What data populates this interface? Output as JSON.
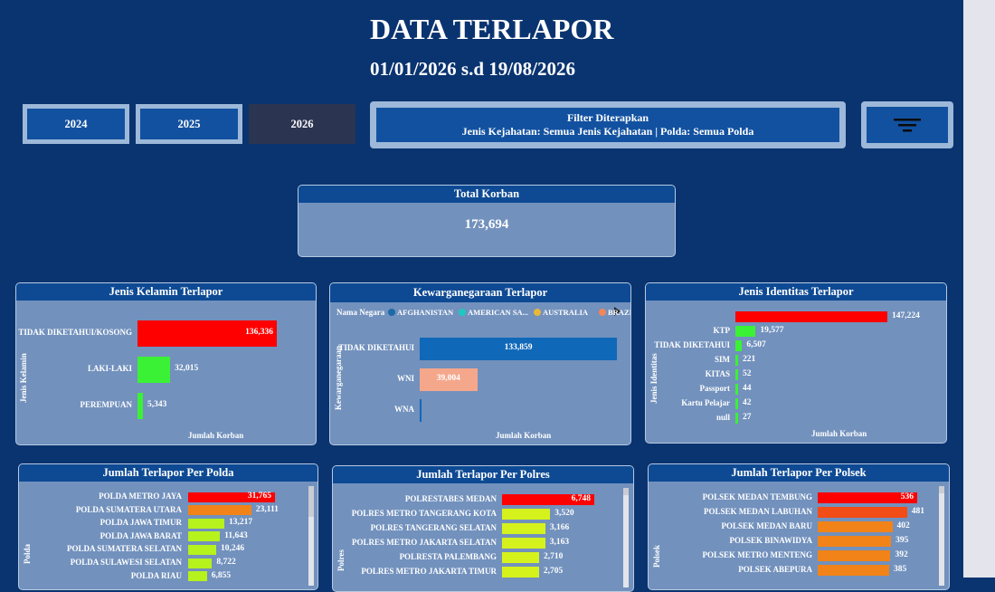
{
  "header": {
    "title": "DATA TERLAPOR",
    "date_range": "01/01/2026 s.d 19/08/2026"
  },
  "year_buttons": [
    {
      "label": "2024",
      "selected": false
    },
    {
      "label": "2025",
      "selected": false
    },
    {
      "label": "2026",
      "selected": true
    }
  ],
  "filter": {
    "title": "Filter Diterapkan",
    "text": "Jenis Kejahatan: Semua Jenis Kejahatan | Polda: Semua Polda",
    "button_icon": "filter-icon"
  },
  "total": {
    "title": "Total Korban",
    "value": "173,694"
  },
  "gender": {
    "title": "Jenis Kelamin Terlapor",
    "ylabel": "Jenis Kelamin",
    "xlabel": "Jumlah Korban",
    "rows": [
      {
        "label": "TIDAK DIKETAHUI/KOSONG",
        "value": 136336,
        "text": "136,336",
        "color": "#fe0000"
      },
      {
        "label": "LAKI-LAKI",
        "value": 32015,
        "text": "32,015",
        "color": "#3bf135"
      },
      {
        "label": "PEREMPUAN",
        "value": 5343,
        "text": "5,343",
        "color": "#3bf135"
      }
    ]
  },
  "citizenship": {
    "title": "Kewarganegaraan Terlapor",
    "ylabel": "Kewarganegaraan",
    "xlabel": "Jumlah Korban",
    "legend_title": "Nama Negara",
    "legend": [
      {
        "label": "AFGHANISTAN",
        "color": "#1c6aa8"
      },
      {
        "label": "AMERICAN SA...",
        "color": "#1ec8c0"
      },
      {
        "label": "AUSTRALIA",
        "color": "#e9b83a"
      },
      {
        "label": "BRAZIL",
        "color": "#f3855a"
      }
    ],
    "rows": [
      {
        "label": "TIDAK DIKETAHUI",
        "value": 133859,
        "text": "133,859",
        "color": "#1068b9"
      },
      {
        "label": "WNI",
        "value": 39004,
        "text": "39,004",
        "color": "#f5a78b"
      },
      {
        "label": "WNA",
        "value": 831,
        "text": "",
        "color": "#1068b9"
      }
    ]
  },
  "identity": {
    "title": "Jenis Identitas Terlapor",
    "ylabel": "Jenis Identitas",
    "xlabel": "Jumlah Korban",
    "rows": [
      {
        "label": "",
        "value": 147224,
        "text": "147,224",
        "color": "#fe0000"
      },
      {
        "label": "KTP",
        "value": 19577,
        "text": "19,577",
        "color": "#3bf135"
      },
      {
        "label": "TIDAK DIKETAHUI",
        "value": 6507,
        "text": "6,507",
        "color": "#3bf135"
      },
      {
        "label": "SIM",
        "value": 221,
        "text": "221",
        "color": "#3bf135"
      },
      {
        "label": "KITAS",
        "value": 52,
        "text": "52",
        "color": "#3bf135"
      },
      {
        "label": "Passport",
        "value": 44,
        "text": "44",
        "color": "#3bf135"
      },
      {
        "label": "Kartu Pelajar",
        "value": 42,
        "text": "42",
        "color": "#3bf135"
      },
      {
        "label": "null",
        "value": 27,
        "text": "27",
        "color": "#3bf135"
      }
    ]
  },
  "polda": {
    "title": "Jumlah Terlapor Per Polda",
    "ylabel": "Polda",
    "rows": [
      {
        "label": "POLDA METRO JAYA",
        "value": 31765,
        "text": "31,765",
        "color": "#fe0000"
      },
      {
        "label": "POLDA SUMATERA UTARA",
        "value": 23111,
        "text": "23,111",
        "color": "#f28318"
      },
      {
        "label": "POLDA JAWA TIMUR",
        "value": 13217,
        "text": "13,217",
        "color": "#b6f21c"
      },
      {
        "label": "POLDA JAWA BARAT",
        "value": 11643,
        "text": "11,643",
        "color": "#b6f21c"
      },
      {
        "label": "POLDA SUMATERA SELATAN",
        "value": 10246,
        "text": "10,246",
        "color": "#b6f21c"
      },
      {
        "label": "POLDA SULAWESI SELATAN",
        "value": 8722,
        "text": "8,722",
        "color": "#b6f21c"
      },
      {
        "label": "POLDA RIAU",
        "value": 6855,
        "text": "6,855",
        "color": "#b6f21c"
      }
    ]
  },
  "polres": {
    "title": "Jumlah Terlapor Per Polres",
    "ylabel": "Polres",
    "rows": [
      {
        "label": "POLRESTABES MEDAN",
        "value": 6748,
        "text": "6,748",
        "color": "#fe0000"
      },
      {
        "label": "POLRES METRO TANGERANG KOTA",
        "value": 3520,
        "text": "3,520",
        "color": "#d6f21c"
      },
      {
        "label": "POLRES TANGERANG SELATAN",
        "value": 3166,
        "text": "3,166",
        "color": "#d6f21c"
      },
      {
        "label": "POLRES METRO JAKARTA SELATAN",
        "value": 3163,
        "text": "3,163",
        "color": "#d6f21c"
      },
      {
        "label": "POLRESTA PALEMBANG",
        "value": 2710,
        "text": "2,710",
        "color": "#d6f21c"
      },
      {
        "label": "POLRES METRO JAKARTA TIMUR",
        "value": 2705,
        "text": "2,705",
        "color": "#d6f21c"
      }
    ]
  },
  "polsek": {
    "title": "Jumlah Terlapor Per Polsek",
    "ylabel": "Polsek",
    "rows": [
      {
        "label": "POLSEK MEDAN TEMBUNG",
        "value": 536,
        "text": "536",
        "color": "#fe0000"
      },
      {
        "label": "POLSEK MEDAN LABUHAN",
        "value": 481,
        "text": "481",
        "color": "#f24d16"
      },
      {
        "label": "POLSEK MEDAN BARU",
        "value": 402,
        "text": "402",
        "color": "#f28318"
      },
      {
        "label": "POLSEK BINAWIDYA",
        "value": 395,
        "text": "395",
        "color": "#f28318"
      },
      {
        "label": "POLSEK METRO MENTENG",
        "value": 392,
        "text": "392",
        "color": "#f28318"
      },
      {
        "label": "POLSEK ABEPURA",
        "value": 385,
        "text": "385",
        "color": "#f28318"
      }
    ]
  }
}
